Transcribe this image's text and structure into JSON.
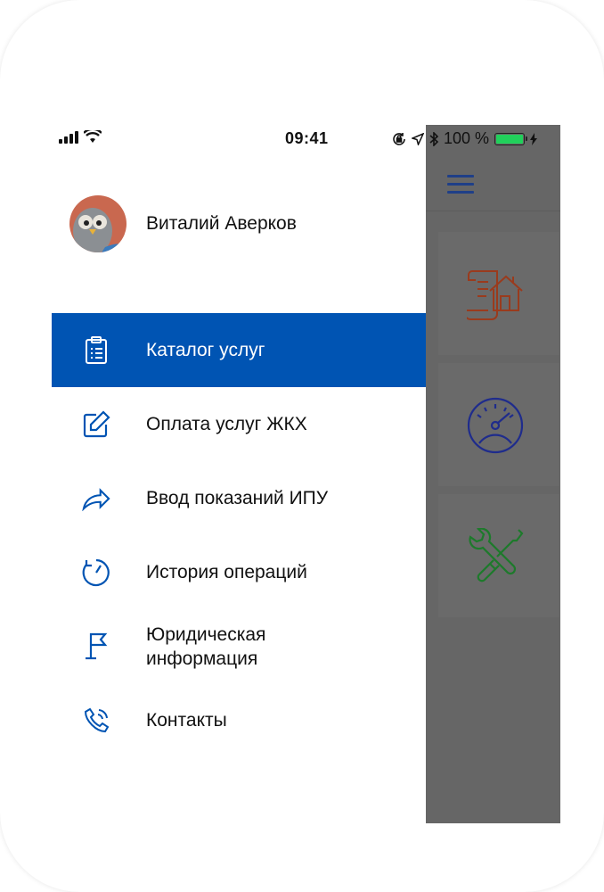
{
  "status_bar": {
    "time": "09:41",
    "battery_percent": "100 %",
    "battery_level": 1.0
  },
  "profile": {
    "name": "Виталий Аверков"
  },
  "menu": {
    "items": [
      {
        "label": "Каталог услуг",
        "icon": "clipboard-list-icon",
        "active": true
      },
      {
        "label": "Оплата услуг ЖКХ",
        "icon": "edit-pencil-icon",
        "active": false
      },
      {
        "label": "Ввод показаний ИПУ",
        "icon": "share-arrow-icon",
        "active": false
      },
      {
        "label": "История операций",
        "icon": "clock-history-icon",
        "active": false
      },
      {
        "label": "Юридическая информация",
        "icon": "flag-icon",
        "active": false
      },
      {
        "label": "Контакты",
        "icon": "phone-call-icon",
        "active": false
      }
    ]
  },
  "underlay": {
    "tiles": [
      {
        "icon": "house-document-icon",
        "color": "#9a3b1d"
      },
      {
        "icon": "speedometer-icon",
        "color": "#1f2c8c"
      },
      {
        "icon": "tools-wrench-screwdriver-icon",
        "color": "#1d7a2b"
      }
    ]
  },
  "colors": {
    "accent": "#0054b3",
    "icon": "#0054b3",
    "overlay": "#666666"
  }
}
